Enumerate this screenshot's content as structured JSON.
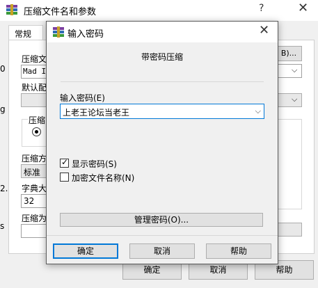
{
  "background_window": {
    "title": "压缩文件名和参数",
    "help_glyph": "?",
    "close_glyph": "✕",
    "tab_label": "常规",
    "field_archive_label": "压缩文",
    "field_archive_value": "Mad Is",
    "browse_button_fragment": "B)...",
    "default_profile_label": "默认配",
    "format_group_label": "压缩",
    "method_label": "压缩方",
    "method_value": "标准",
    "dict_label": "字典大",
    "dict_value": "32",
    "split_label": "压缩为",
    "left_edge_chars": [
      "0",
      "g",
      "2.",
      "s"
    ],
    "ok_label": "确定",
    "cancel_label": "取消",
    "help_label": "帮助"
  },
  "dialog": {
    "title": "输入密码",
    "heading": "带密码压缩",
    "password_label": "输入密码(E)",
    "password_value": "上老王论坛当老王",
    "show_password_label": "显示密码(S)",
    "show_password_checked": true,
    "encrypt_names_label": "加密文件名称(N)",
    "encrypt_names_checked": false,
    "manage_button": "管理密码(O)...",
    "ok_button": "确定",
    "cancel_button": "取消",
    "help_button": "帮助",
    "close_glyph": "✕",
    "dropdown_glyph": "⌵"
  },
  "colors": {
    "focus_blue": "#0078d7",
    "button_face": "#e1e1e1",
    "dialog_face": "#f0f0f0"
  }
}
